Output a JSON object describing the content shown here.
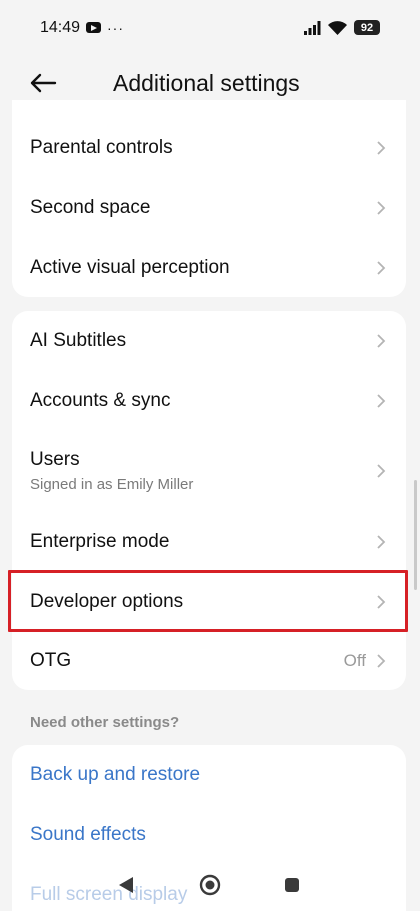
{
  "status_bar": {
    "time": "14:49",
    "more": "···",
    "battery": "92"
  },
  "header": {
    "title": "Additional settings"
  },
  "card1": {
    "items": [
      {
        "label": "Parental controls"
      },
      {
        "label": "Second space"
      },
      {
        "label": "Active visual perception"
      }
    ]
  },
  "card2": {
    "items": [
      {
        "label": "AI Subtitles"
      },
      {
        "label": "Accounts & sync"
      },
      {
        "label": "Users",
        "sublabel": "Signed in as Emily Miller"
      },
      {
        "label": "Enterprise mode"
      },
      {
        "label": "Developer options"
      },
      {
        "label": "OTG",
        "value": "Off"
      }
    ]
  },
  "other": {
    "section_title": "Need other settings?",
    "links": [
      {
        "label": "Back up and restore"
      },
      {
        "label": "Sound effects"
      },
      {
        "label": "Full screen display"
      }
    ]
  },
  "colors": {
    "accent_link": "#3a76c8",
    "highlight": "#d62026"
  }
}
